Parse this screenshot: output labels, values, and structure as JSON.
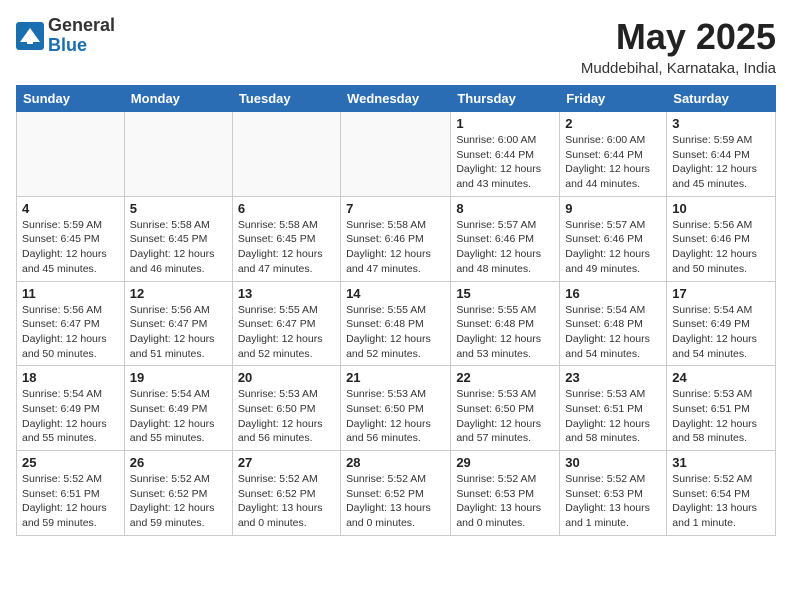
{
  "logo": {
    "general": "General",
    "blue": "Blue"
  },
  "title": {
    "month_year": "May 2025",
    "location": "Muddebihal, Karnataka, India"
  },
  "headers": [
    "Sunday",
    "Monday",
    "Tuesday",
    "Wednesday",
    "Thursday",
    "Friday",
    "Saturday"
  ],
  "weeks": [
    [
      {
        "day": "",
        "info": ""
      },
      {
        "day": "",
        "info": ""
      },
      {
        "day": "",
        "info": ""
      },
      {
        "day": "",
        "info": ""
      },
      {
        "day": "1",
        "info": "Sunrise: 6:00 AM\nSunset: 6:44 PM\nDaylight: 12 hours\nand 43 minutes."
      },
      {
        "day": "2",
        "info": "Sunrise: 6:00 AM\nSunset: 6:44 PM\nDaylight: 12 hours\nand 44 minutes."
      },
      {
        "day": "3",
        "info": "Sunrise: 5:59 AM\nSunset: 6:44 PM\nDaylight: 12 hours\nand 45 minutes."
      }
    ],
    [
      {
        "day": "4",
        "info": "Sunrise: 5:59 AM\nSunset: 6:45 PM\nDaylight: 12 hours\nand 45 minutes."
      },
      {
        "day": "5",
        "info": "Sunrise: 5:58 AM\nSunset: 6:45 PM\nDaylight: 12 hours\nand 46 minutes."
      },
      {
        "day": "6",
        "info": "Sunrise: 5:58 AM\nSunset: 6:45 PM\nDaylight: 12 hours\nand 47 minutes."
      },
      {
        "day": "7",
        "info": "Sunrise: 5:58 AM\nSunset: 6:46 PM\nDaylight: 12 hours\nand 47 minutes."
      },
      {
        "day": "8",
        "info": "Sunrise: 5:57 AM\nSunset: 6:46 PM\nDaylight: 12 hours\nand 48 minutes."
      },
      {
        "day": "9",
        "info": "Sunrise: 5:57 AM\nSunset: 6:46 PM\nDaylight: 12 hours\nand 49 minutes."
      },
      {
        "day": "10",
        "info": "Sunrise: 5:56 AM\nSunset: 6:46 PM\nDaylight: 12 hours\nand 50 minutes."
      }
    ],
    [
      {
        "day": "11",
        "info": "Sunrise: 5:56 AM\nSunset: 6:47 PM\nDaylight: 12 hours\nand 50 minutes."
      },
      {
        "day": "12",
        "info": "Sunrise: 5:56 AM\nSunset: 6:47 PM\nDaylight: 12 hours\nand 51 minutes."
      },
      {
        "day": "13",
        "info": "Sunrise: 5:55 AM\nSunset: 6:47 PM\nDaylight: 12 hours\nand 52 minutes."
      },
      {
        "day": "14",
        "info": "Sunrise: 5:55 AM\nSunset: 6:48 PM\nDaylight: 12 hours\nand 52 minutes."
      },
      {
        "day": "15",
        "info": "Sunrise: 5:55 AM\nSunset: 6:48 PM\nDaylight: 12 hours\nand 53 minutes."
      },
      {
        "day": "16",
        "info": "Sunrise: 5:54 AM\nSunset: 6:48 PM\nDaylight: 12 hours\nand 54 minutes."
      },
      {
        "day": "17",
        "info": "Sunrise: 5:54 AM\nSunset: 6:49 PM\nDaylight: 12 hours\nand 54 minutes."
      }
    ],
    [
      {
        "day": "18",
        "info": "Sunrise: 5:54 AM\nSunset: 6:49 PM\nDaylight: 12 hours\nand 55 minutes."
      },
      {
        "day": "19",
        "info": "Sunrise: 5:54 AM\nSunset: 6:49 PM\nDaylight: 12 hours\nand 55 minutes."
      },
      {
        "day": "20",
        "info": "Sunrise: 5:53 AM\nSunset: 6:50 PM\nDaylight: 12 hours\nand 56 minutes."
      },
      {
        "day": "21",
        "info": "Sunrise: 5:53 AM\nSunset: 6:50 PM\nDaylight: 12 hours\nand 56 minutes."
      },
      {
        "day": "22",
        "info": "Sunrise: 5:53 AM\nSunset: 6:50 PM\nDaylight: 12 hours\nand 57 minutes."
      },
      {
        "day": "23",
        "info": "Sunrise: 5:53 AM\nSunset: 6:51 PM\nDaylight: 12 hours\nand 58 minutes."
      },
      {
        "day": "24",
        "info": "Sunrise: 5:53 AM\nSunset: 6:51 PM\nDaylight: 12 hours\nand 58 minutes."
      }
    ],
    [
      {
        "day": "25",
        "info": "Sunrise: 5:52 AM\nSunset: 6:51 PM\nDaylight: 12 hours\nand 59 minutes."
      },
      {
        "day": "26",
        "info": "Sunrise: 5:52 AM\nSunset: 6:52 PM\nDaylight: 12 hours\nand 59 minutes."
      },
      {
        "day": "27",
        "info": "Sunrise: 5:52 AM\nSunset: 6:52 PM\nDaylight: 13 hours\nand 0 minutes."
      },
      {
        "day": "28",
        "info": "Sunrise: 5:52 AM\nSunset: 6:52 PM\nDaylight: 13 hours\nand 0 minutes."
      },
      {
        "day": "29",
        "info": "Sunrise: 5:52 AM\nSunset: 6:53 PM\nDaylight: 13 hours\nand 0 minutes."
      },
      {
        "day": "30",
        "info": "Sunrise: 5:52 AM\nSunset: 6:53 PM\nDaylight: 13 hours\nand 1 minute."
      },
      {
        "day": "31",
        "info": "Sunrise: 5:52 AM\nSunset: 6:54 PM\nDaylight: 13 hours\nand 1 minute."
      }
    ]
  ]
}
